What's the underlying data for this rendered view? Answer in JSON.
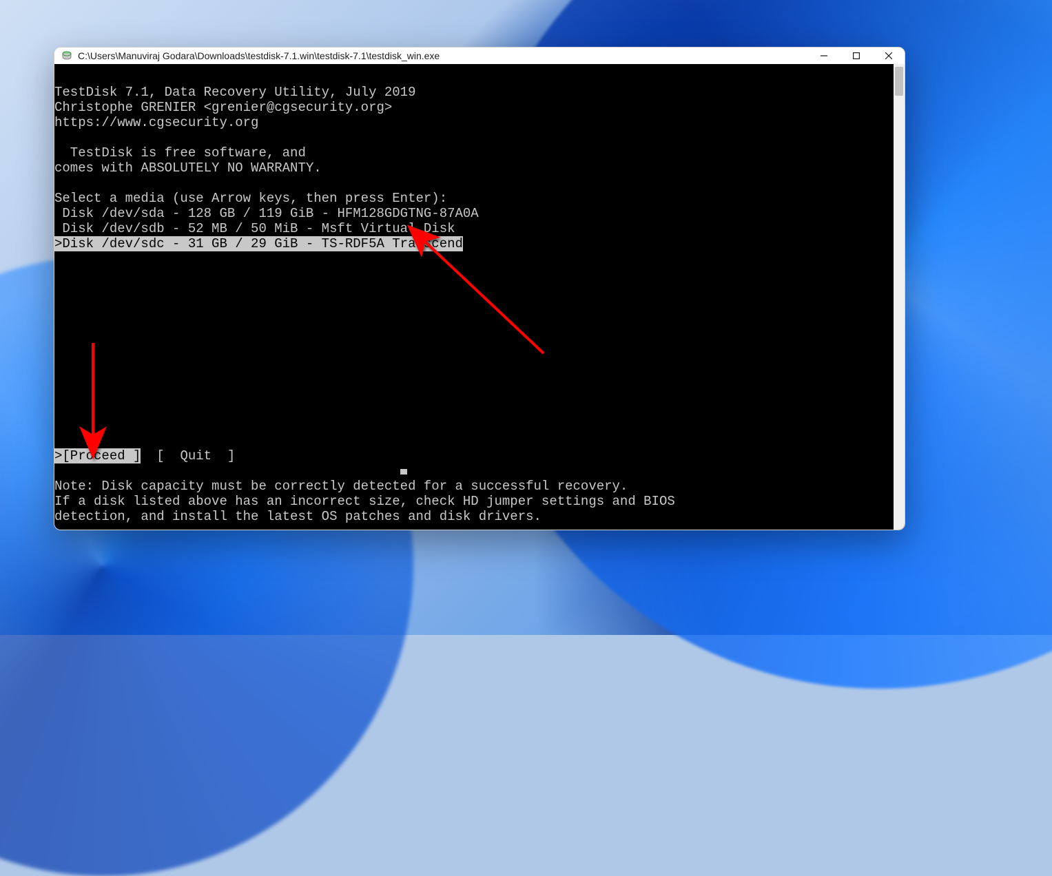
{
  "window": {
    "title_path": "C:\\Users\\Manuviraj Godara\\Downloads\\testdisk-7.1.win\\testdisk-7.1\\testdisk_win.exe"
  },
  "console": {
    "header_line1": "TestDisk 7.1, Data Recovery Utility, July 2019",
    "header_line2": "Christophe GRENIER <grenier@cgsecurity.org>",
    "header_line3": "https://www.cgsecurity.org",
    "free_line1": "  TestDisk is free software, and",
    "free_line2": "comes with ABSOLUTELY NO WARRANTY.",
    "select_prompt": "Select a media (use Arrow keys, then press Enter):",
    "disks": [
      " Disk /dev/sda - 128 GB / 119 GiB - HFM128GDGTNG-87A0A",
      " Disk /dev/sdb - 52 MB / 50 MiB - Msft Virtual Disk"
    ],
    "selected_disk_prefix": ">",
    "selected_disk_text": "Disk /dev/sdc - 31 GB / 29 GiB - TS-RDF5A Transcend",
    "menu_selected_prefix": ">",
    "menu_proceed": "[Proceed ]",
    "menu_gap": "  ",
    "menu_quit": "[  Quit  ]",
    "note_line1": "Note: Disk capacity must be correctly detected for a successful recovery.",
    "note_line2": "If a disk listed above has an incorrect size, check HD jumper settings and BIOS",
    "note_line3": "detection, and install the latest OS patches and disk drivers."
  },
  "annotations": {
    "arrow_color": "#ff0000"
  }
}
